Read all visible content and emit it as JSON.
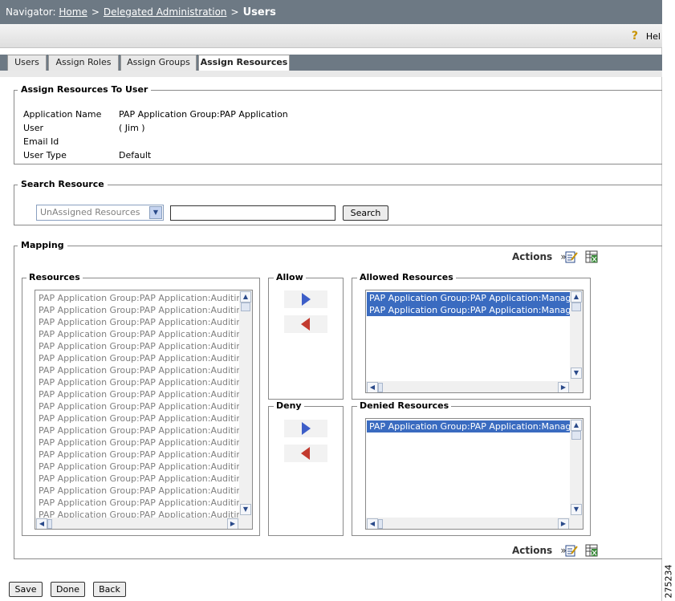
{
  "navigator": {
    "prefix": "Navigator:",
    "crumbs": [
      "Home",
      "Delegated Administration"
    ],
    "sep": ">",
    "current": "Users"
  },
  "help": {
    "label": "Hel"
  },
  "tabs": [
    {
      "label": "Users",
      "active": false
    },
    {
      "label": "Assign Roles",
      "active": false
    },
    {
      "label": "Assign Groups",
      "active": false
    },
    {
      "label": "Assign Resources",
      "active": true
    }
  ],
  "user_section": {
    "legend": "Assign Resources To User",
    "fields": [
      {
        "label": "Application Name",
        "value": "PAP Application Group:PAP Application"
      },
      {
        "label": "User",
        "value": "( Jim )"
      },
      {
        "label": "Email Id",
        "value": ""
      },
      {
        "label": "User Type",
        "value": "Default"
      }
    ]
  },
  "search": {
    "legend": "Search Resource",
    "filter_selected": "UnAssigned Resources",
    "query": "",
    "button": "Search"
  },
  "mapping": {
    "legend": "Mapping",
    "actions_label": "Actions",
    "actions_chevron": "»",
    "resources_label": "Resources",
    "resource_items": [
      "PAP Application Group:PAP Application:Auditing",
      "PAP Application Group:PAP Application:Auditing",
      "PAP Application Group:PAP Application:Auditing",
      "PAP Application Group:PAP Application:Auditing",
      "PAP Application Group:PAP Application:Auditing",
      "PAP Application Group:PAP Application:Auditing",
      "PAP Application Group:PAP Application:Auditing",
      "PAP Application Group:PAP Application:Auditing",
      "PAP Application Group:PAP Application:Auditing",
      "PAP Application Group:PAP Application:Auditing",
      "PAP Application Group:PAP Application:Auditing",
      "PAP Application Group:PAP Application:Auditing",
      "PAP Application Group:PAP Application:Auditing",
      "PAP Application Group:PAP Application:Auditing",
      "PAP Application Group:PAP Application:Auditing",
      "PAP Application Group:PAP Application:Auditing",
      "PAP Application Group:PAP Application:Auditing",
      "PAP Application Group:PAP Application:Auditing",
      "PAP Application Group:PAP Application:Auditing"
    ],
    "allow_label": "Allow",
    "deny_label": "Deny",
    "allowed_label": "Allowed Resources",
    "allowed_items": [
      "PAP Application Group:PAP Application:Manage",
      "PAP Application Group:PAP Application:Manage"
    ],
    "denied_label": "Denied Resources",
    "denied_items": [
      "PAP Application Group:PAP Application:Manage"
    ]
  },
  "footer": {
    "save": "Save",
    "done": "Done",
    "back": "Back"
  },
  "watermark": "275234",
  "icons": {
    "help": "help-question-icon",
    "edit": "edit-note-icon",
    "export": "export-grid-icon",
    "move_right": "arrow-right-icon",
    "move_left": "arrow-left-icon"
  },
  "colors": {
    "navbar": "#6d7984",
    "selection": "#3a6bc0",
    "arrow_right": "#3d5ec8",
    "arrow_left": "#c23a2e"
  }
}
